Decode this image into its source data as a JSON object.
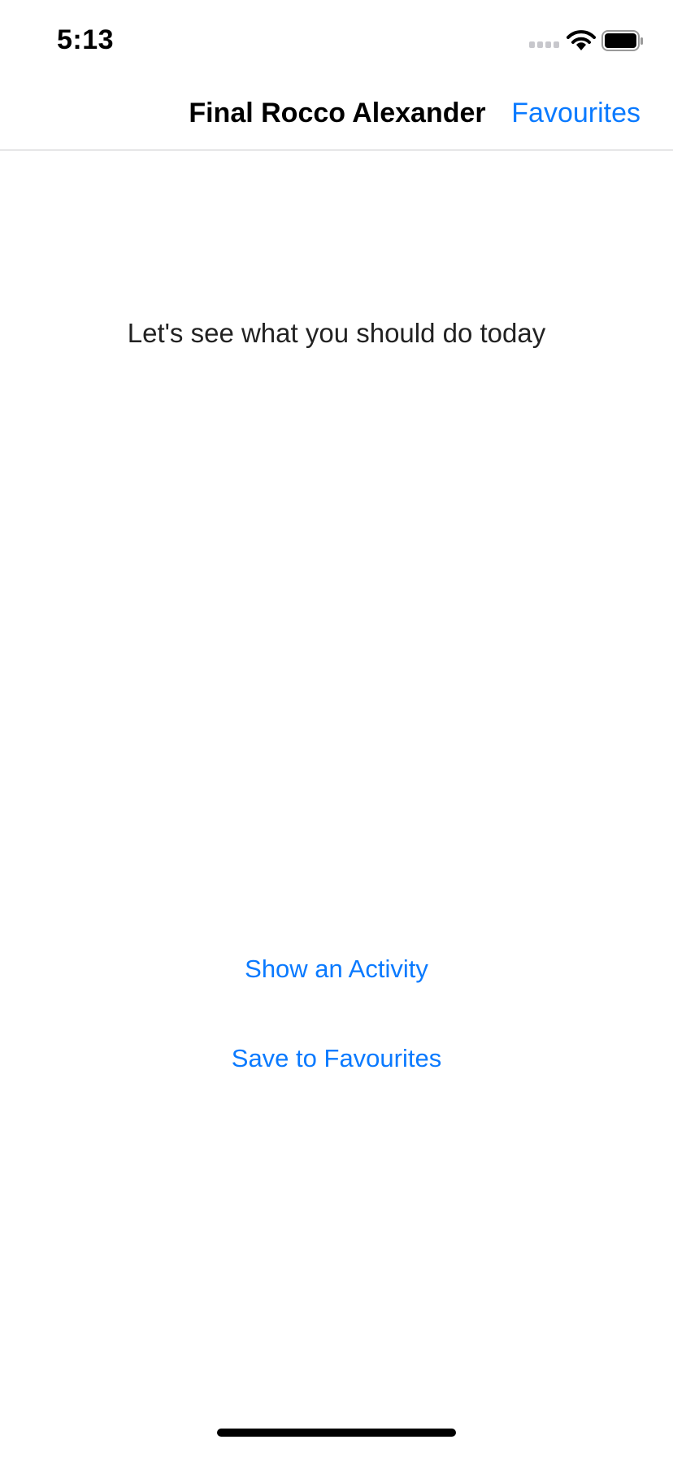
{
  "status_bar": {
    "time": "5:13",
    "signal_icon": "signal-dots-icon",
    "wifi_icon": "wifi-icon",
    "battery_icon": "battery-icon"
  },
  "nav": {
    "title": "Final Rocco Alexander",
    "right_action": "Favourites"
  },
  "main": {
    "prompt": "Let's see what you should do today",
    "show_activity_label": "Show an Activity",
    "save_favourites_label": "Save to Favourites"
  },
  "colors": {
    "accent": "#0a7aff",
    "background": "#ffffff",
    "separator": "#c6c6c8"
  }
}
